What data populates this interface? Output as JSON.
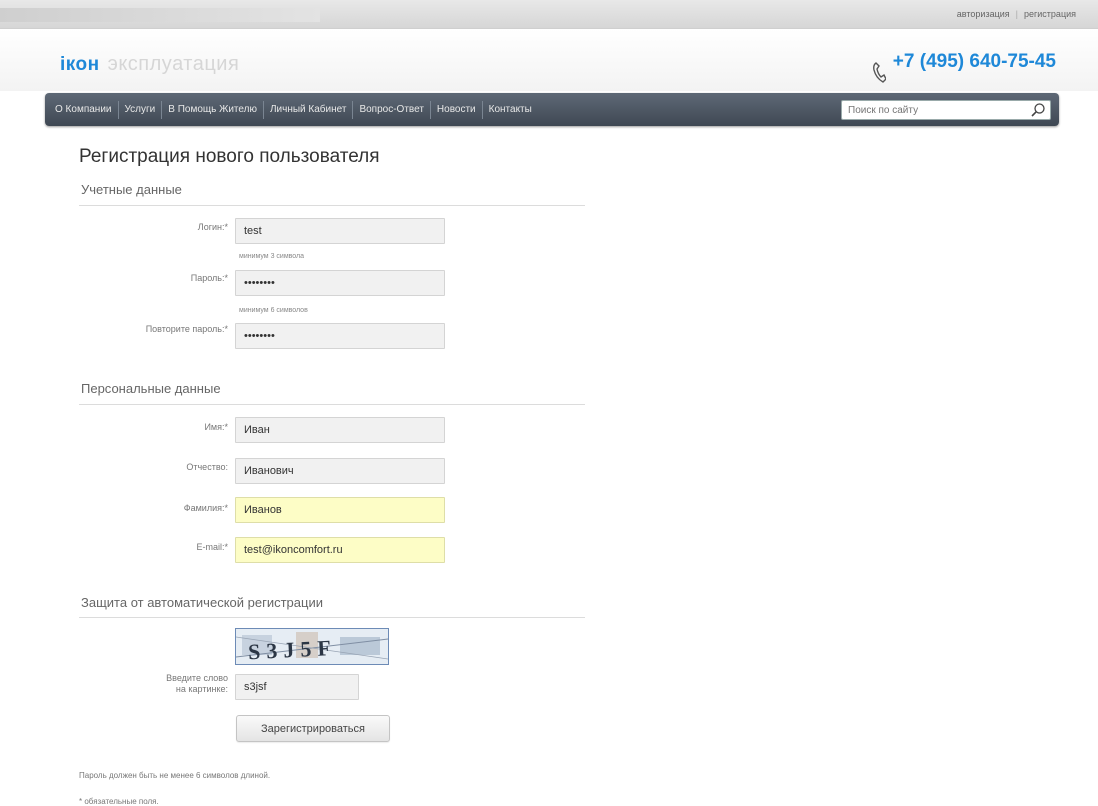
{
  "toplinks": {
    "login": "авторизация",
    "register": "регистрация"
  },
  "logo": {
    "brand": "ікон",
    "sub": "эксплуатация"
  },
  "phone": "+7 (495) 640-75-45",
  "nav": [
    "О Компании",
    "Услуги",
    "В Помощь Жителю",
    "Личный Кабинет",
    "Вопрос-Ответ",
    "Новости",
    "Контакты"
  ],
  "search": {
    "placeholder": "Поиск по сайту"
  },
  "page_title": "Регистрация нового пользователя",
  "sections": {
    "account": "Учетные данные",
    "personal": "Персональные данные",
    "protection": "Защита от автоматической регистрации"
  },
  "account_fields": {
    "login_label": "Логин:",
    "login_value": "test",
    "login_hint": "минимум 3 символа",
    "password_label": "Пароль:",
    "password_value": "••••••••",
    "password_hint": "минимум 6 символов",
    "confirm_label": "Повторите пароль:",
    "confirm_value": "••••••••"
  },
  "personal_fields": {
    "name_label": "Имя:",
    "name_value": "Иван",
    "patronymic_label": "Отчество:",
    "patronymic_value": "Иванович",
    "surname_label": "Фамилия:",
    "surname_value": "Иванов",
    "email_label": "E-mail:",
    "email_value": "test@ikoncomfort.ru"
  },
  "captcha": {
    "image_text": "S3J5F",
    "label_line1": "Введите слово",
    "label_line2": "на картинке:",
    "value": "s3jsf"
  },
  "submit_label": "Зарегистрироваться",
  "notes": {
    "password_note": "Пароль должен быть не менее 6 символов длиной.",
    "required_note": "* обязательные поля."
  },
  "colors": {
    "accent": "#1e88d8",
    "nav_bg": "#4a5460",
    "highlight": "#fdfdc6"
  }
}
